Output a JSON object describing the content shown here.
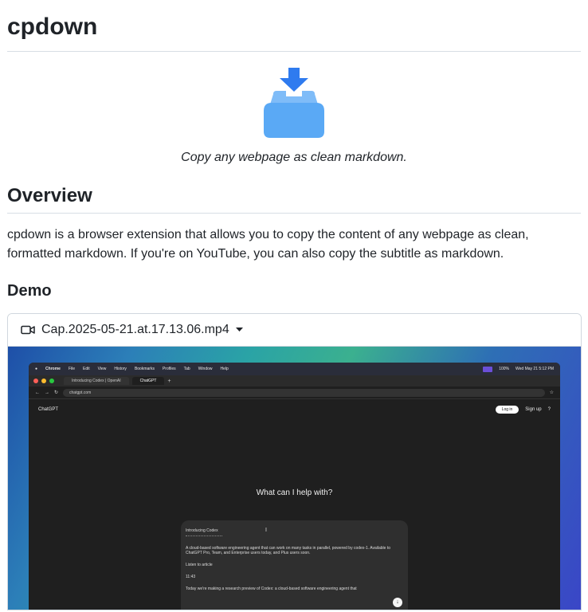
{
  "title": "cpdown",
  "hero": {
    "tagline": "Copy any webpage as clean markdown.",
    "icon": "download-tray-icon",
    "colors": {
      "arrow": "#2f7bef",
      "tray": "#5aa9f5"
    }
  },
  "overview": {
    "heading": "Overview",
    "text": "cpdown is a browser extension that allows you to copy the content of any webpage as clean, formatted markdown. If you're on YouTube, you can also copy the subtitle as markdown."
  },
  "demo": {
    "heading": "Demo",
    "video_filename": "Cap.2025-05-21.at.17.13.06.mp4",
    "screen": {
      "menubar": {
        "app": "Chrome",
        "items": [
          "File",
          "Edit",
          "View",
          "History",
          "Bookmarks",
          "Profiles",
          "Tab",
          "Window",
          "Help"
        ],
        "status": "100%",
        "datetime": "Wed May 21 5:12 PM"
      },
      "tabs": [
        "Introducing Codex | OpenAI",
        "ChatGPT"
      ],
      "url": "chatgpt.com",
      "app_name": "ChatGPT",
      "login": "Log in",
      "signup": "Sign up",
      "prompt": "What can I help with?",
      "card": {
        "title": "Introducing Codex",
        "body": "A cloud-based software engineering agent that can work on many tasks in parallel, powered by codex-1. Available to ChatGPT Pro, Team, and Enterprise users today, and Plus users soon.",
        "listen": "Listen to article",
        "duration": "11:43",
        "footer": "Today we're making a research preview of Codex: a cloud-based software engineering agent that"
      }
    }
  }
}
